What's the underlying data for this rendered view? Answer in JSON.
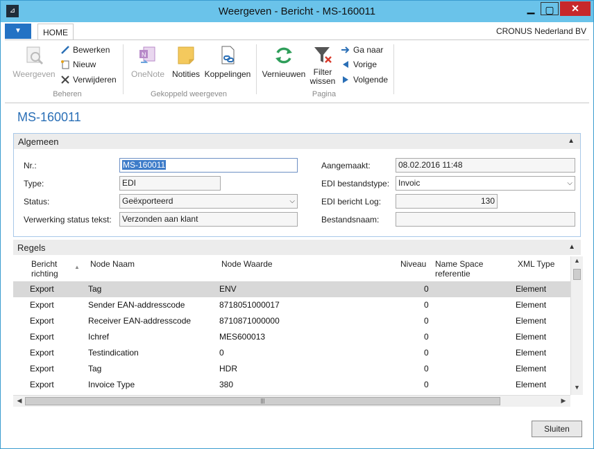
{
  "window": {
    "title": "Weergeven - Bericht - MS-160011"
  },
  "ribbon": {
    "tab_home": "HOME",
    "company": "CRONUS Nederland BV",
    "weergeven": "Weergeven",
    "bewerken": "Bewerken",
    "nieuw": "Nieuw",
    "verwijderen": "Verwijderen",
    "group_beheren": "Beheren",
    "onenote": "OneNote",
    "notities": "Notities",
    "koppelingen": "Koppelingen",
    "group_gekoppeld": "Gekoppeld weergeven",
    "vernieuwen": "Vernieuwen",
    "filter_wissen_1": "Filter",
    "filter_wissen_2": "wissen",
    "ga_naar": "Ga naar",
    "vorige": "Vorige",
    "volgende": "Volgende",
    "group_pagina": "Pagina"
  },
  "page": {
    "title": "MS-160011"
  },
  "algemeen": {
    "header": "Algemeen",
    "nr_label": "Nr.:",
    "nr_value": "MS-160011",
    "type_label": "Type:",
    "type_value": "EDI",
    "status_label": "Status:",
    "status_value": "Geëxporteerd",
    "verwerking_label": "Verwerking status tekst:",
    "verwerking_value": "Verzonden aan klant",
    "aangemaakt_label": "Aangemaakt:",
    "aangemaakt_value": "08.02.2016 11:48",
    "bestandstype_label": "EDI bestandstype:",
    "bestandstype_value": "Invoic",
    "log_label": "EDI bericht Log:",
    "log_value": "130",
    "bestandsnaam_label": "Bestandsnaam:",
    "bestandsnaam_value": ""
  },
  "regels": {
    "header": "Regels",
    "columns": {
      "richting_1": "Bericht",
      "richting_2": "richting",
      "node_naam": "Node Naam",
      "node_waarde": "Node Waarde",
      "niveau": "Niveau",
      "namespace_1": "Name Space",
      "namespace_2": "referentie",
      "xml_type": "XML Type"
    },
    "rows": [
      {
        "richting": "Export",
        "naam": "Tag",
        "waarde": "ENV",
        "niveau": "0",
        "ns": "",
        "type": "Element"
      },
      {
        "richting": "Export",
        "naam": "Sender EAN-addresscode",
        "waarde": "8718051000017",
        "niveau": "0",
        "ns": "",
        "type": "Element"
      },
      {
        "richting": "Export",
        "naam": "Receiver EAN-addresscode",
        "waarde": "8710871000000",
        "niveau": "0",
        "ns": "",
        "type": "Element"
      },
      {
        "richting": "Export",
        "naam": "Ichref",
        "waarde": "MES600013",
        "niveau": "0",
        "ns": "",
        "type": "Element"
      },
      {
        "richting": "Export",
        "naam": "Testindication",
        "waarde": "0",
        "niveau": "0",
        "ns": "",
        "type": "Element"
      },
      {
        "richting": "Export",
        "naam": "Tag",
        "waarde": "HDR",
        "niveau": "0",
        "ns": "",
        "type": "Element"
      },
      {
        "richting": "Export",
        "naam": "Invoice Type",
        "waarde": "380",
        "niveau": "0",
        "ns": "",
        "type": "Element"
      }
    ]
  },
  "footer": {
    "sluiten": "Sluiten"
  }
}
